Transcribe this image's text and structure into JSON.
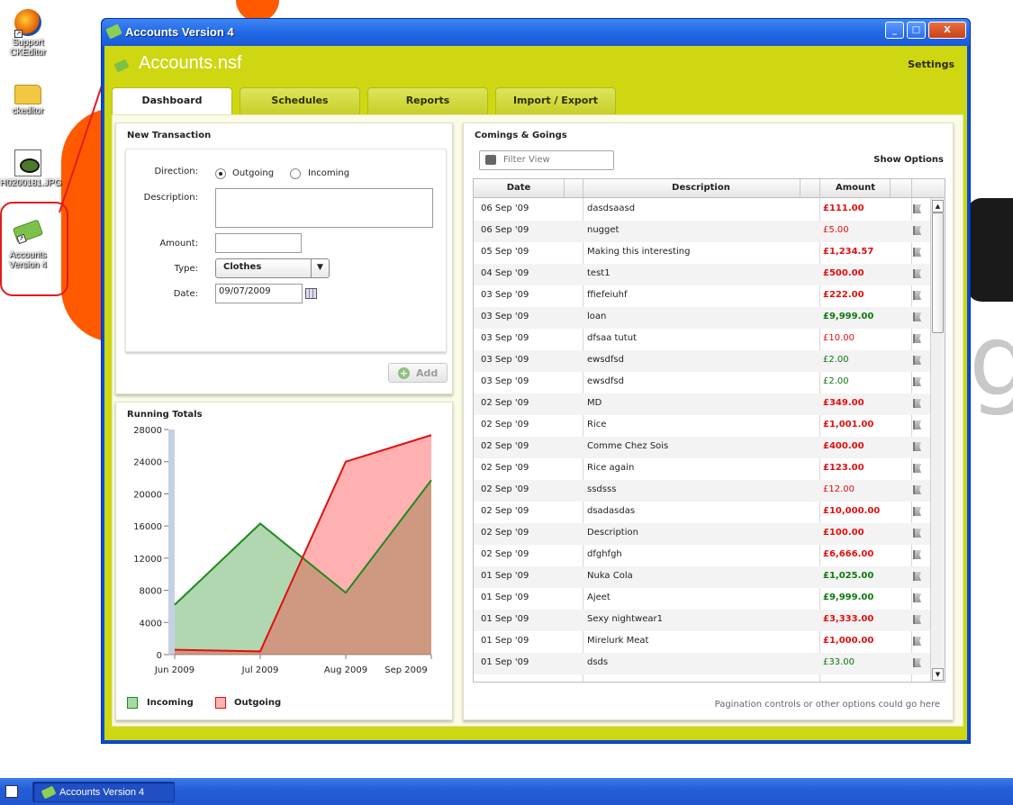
{
  "colors": {
    "app_header": "#ced711",
    "titlebar": "#2369e6",
    "outgoing": "#e01010",
    "incoming": "#0d7a0d"
  },
  "desktop": {
    "icons": [
      {
        "label": "Support CKEditor",
        "icon": "firefox-icon"
      },
      {
        "label": "ckeditor",
        "icon": "folder-icon"
      },
      {
        "label": "H0200181.JPG",
        "icon": "image-file-icon"
      },
      {
        "label": "Accounts Version 4",
        "icon": "money-icon"
      }
    ]
  },
  "window": {
    "title": "Accounts Version 4",
    "buttons": {
      "minimize": "_",
      "maximize": "□",
      "close": "X"
    }
  },
  "app": {
    "title": "Accounts.nsf",
    "settings_label": "Settings",
    "tabs": [
      "Dashboard",
      "Schedules",
      "Reports",
      "Import / Export"
    ]
  },
  "new_transaction": {
    "title": "New Transaction",
    "direction_label": "Direction:",
    "direction_options": [
      "Outgoing",
      "Incoming"
    ],
    "description_label": "Description:",
    "description_value": "",
    "amount_label": "Amount:",
    "amount_value": "",
    "type_label": "Type:",
    "type_value": "Clothes",
    "date_label": "Date:",
    "date_value": "09/07/2009",
    "add_label": "Add"
  },
  "running_totals": {
    "title": "Running Totals",
    "legend": [
      "Incoming",
      "Outgoing"
    ]
  },
  "chart_data": {
    "type": "area",
    "title": "Running Totals",
    "categories": [
      "Jun 2009",
      "Jul 2009",
      "Aug 2009",
      "Sep 2009"
    ],
    "series": [
      {
        "name": "Incoming",
        "values": [
          6200,
          16300,
          7700,
          21700
        ],
        "color": "#1e8a1e"
      },
      {
        "name": "Outgoing",
        "values": [
          600,
          400,
          24000,
          27300
        ],
        "color": "#e01010"
      }
    ],
    "ylim": [
      0,
      28000
    ],
    "yticks": [
      "28000",
      "24000",
      "20000",
      "16000",
      "12000",
      "8000",
      "4000",
      "0"
    ],
    "legend": "bottom-left",
    "grid": false
  },
  "comings_goings": {
    "title": "Comings & Goings",
    "filter_placeholder": "Filter View",
    "show_options_label": "Show Options",
    "columns": [
      "Date",
      "Description",
      "Amount"
    ],
    "rows": [
      {
        "date": "06 Sep '09",
        "desc": "dasdsaasd",
        "amount": "£111.00",
        "dir": "out",
        "bold": true
      },
      {
        "date": "06 Sep '09",
        "desc": "nugget",
        "amount": "£5.00",
        "dir": "out",
        "bold": false
      },
      {
        "date": "05 Sep '09",
        "desc": "Making this interesting",
        "amount": "£1,234.57",
        "dir": "out",
        "bold": true
      },
      {
        "date": "04 Sep '09",
        "desc": "test1",
        "amount": "£500.00",
        "dir": "out",
        "bold": true
      },
      {
        "date": "03 Sep '09",
        "desc": "ffiefeiuhf",
        "amount": "£222.00",
        "dir": "out",
        "bold": true
      },
      {
        "date": "03 Sep '09",
        "desc": "loan",
        "amount": "£9,999.00",
        "dir": "in",
        "bold": true
      },
      {
        "date": "03 Sep '09",
        "desc": "dfsaa tutut",
        "amount": "£10.00",
        "dir": "out",
        "bold": false
      },
      {
        "date": "03 Sep '09",
        "desc": "ewsdfsd",
        "amount": "£2.00",
        "dir": "in",
        "bold": false
      },
      {
        "date": "03 Sep '09",
        "desc": "ewsdfsd",
        "amount": "£2.00",
        "dir": "in",
        "bold": false
      },
      {
        "date": "02 Sep '09",
        "desc": "MD",
        "amount": "£349.00",
        "dir": "out",
        "bold": true
      },
      {
        "date": "02 Sep '09",
        "desc": "Rice",
        "amount": "£1,001.00",
        "dir": "out",
        "bold": true
      },
      {
        "date": "02 Sep '09",
        "desc": "Comme Chez Sois",
        "amount": "£400.00",
        "dir": "out",
        "bold": true
      },
      {
        "date": "02 Sep '09",
        "desc": "Rice again",
        "amount": "£123.00",
        "dir": "out",
        "bold": true
      },
      {
        "date": "02 Sep '09",
        "desc": "ssdsss",
        "amount": "£12.00",
        "dir": "out",
        "bold": false
      },
      {
        "date": "02 Sep '09",
        "desc": "dsadasdas",
        "amount": "£10,000.00",
        "dir": "out",
        "bold": true
      },
      {
        "date": "02 Sep '09",
        "desc": "Description",
        "amount": "£100.00",
        "dir": "out",
        "bold": true
      },
      {
        "date": "02 Sep '09",
        "desc": "dfghfgh",
        "amount": "£6,666.00",
        "dir": "out",
        "bold": true
      },
      {
        "date": "01 Sep '09",
        "desc": "Nuka Cola",
        "amount": "£1,025.00",
        "dir": "in",
        "bold": true
      },
      {
        "date": "01 Sep '09",
        "desc": "Ajeet",
        "amount": "£9,999.00",
        "dir": "in",
        "bold": true
      },
      {
        "date": "01 Sep '09",
        "desc": "Sexy nightwear1",
        "amount": "£3,333.00",
        "dir": "out",
        "bold": true
      },
      {
        "date": "01 Sep '09",
        "desc": "Mirelurk Meat",
        "amount": "£1,000.00",
        "dir": "out",
        "bold": true
      },
      {
        "date": "01 Sep '09",
        "desc": "dsds",
        "amount": "£33.00",
        "dir": "in",
        "bold": false
      }
    ],
    "pagination_text": "Pagination controls or other options could go here"
  },
  "taskbar": {
    "task_label": "Accounts Version 4"
  }
}
